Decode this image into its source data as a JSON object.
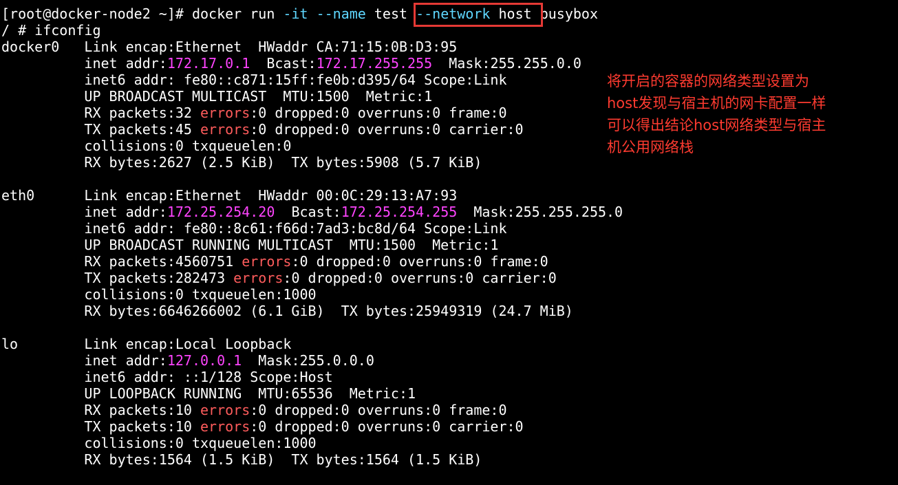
{
  "terminal": {
    "lines": [
      {
        "segments": [
          {
            "text": "[root@docker-node2 ~]# docker run ",
            "color": "default"
          },
          {
            "text": "-it",
            "color": "cyan"
          },
          {
            "text": " ",
            "color": "default"
          },
          {
            "text": "--name",
            "color": "cyan"
          },
          {
            "text": " test ",
            "color": "default"
          },
          {
            "text": "--network",
            "color": "cyan"
          },
          {
            "text": " host busybox",
            "color": "default"
          }
        ]
      },
      {
        "segments": [
          {
            "text": "/ # ifconfig",
            "color": "default"
          }
        ]
      },
      {
        "segments": [
          {
            "text": "docker0   Link encap:Ethernet  HWaddr CA:71:15:0B:D3:95",
            "color": "default"
          }
        ]
      },
      {
        "segments": [
          {
            "text": "          inet addr:",
            "color": "default"
          },
          {
            "text": "172.17.0.1",
            "color": "magenta"
          },
          {
            "text": "  Bcast:",
            "color": "default"
          },
          {
            "text": "172.17.255.255",
            "color": "magenta"
          },
          {
            "text": "  Mask:255.255.0.0",
            "color": "default"
          }
        ]
      },
      {
        "segments": [
          {
            "text": "          inet6 addr: fe80::c871:15ff:fe0b:d395/64 Scope:Link",
            "color": "default"
          }
        ]
      },
      {
        "segments": [
          {
            "text": "          UP BROADCAST MULTICAST  MTU:1500  Metric:1",
            "color": "default"
          }
        ]
      },
      {
        "segments": [
          {
            "text": "          RX packets:32 ",
            "color": "default"
          },
          {
            "text": "errors",
            "color": "red"
          },
          {
            "text": ":0 dropped:0 overruns:0 frame:0",
            "color": "default"
          }
        ]
      },
      {
        "segments": [
          {
            "text": "          TX packets:45 ",
            "color": "default"
          },
          {
            "text": "errors",
            "color": "red"
          },
          {
            "text": ":0 dropped:0 overruns:0 carrier:0",
            "color": "default"
          }
        ]
      },
      {
        "segments": [
          {
            "text": "          collisions:0 txqueuelen:0",
            "color": "default"
          }
        ]
      },
      {
        "segments": [
          {
            "text": "          RX bytes:2627 (2.5 KiB)  TX bytes:5908 (5.7 KiB)",
            "color": "default"
          }
        ]
      },
      {
        "segments": [
          {
            "text": "",
            "color": "default"
          }
        ]
      },
      {
        "segments": [
          {
            "text": "eth0      Link encap:Ethernet  HWaddr 00:0C:29:13:A7:93",
            "color": "default"
          }
        ]
      },
      {
        "segments": [
          {
            "text": "          inet addr:",
            "color": "default"
          },
          {
            "text": "172.25.254.20",
            "color": "magenta"
          },
          {
            "text": "  Bcast:",
            "color": "default"
          },
          {
            "text": "172.25.254.255",
            "color": "magenta"
          },
          {
            "text": "  Mask:255.255.255.0",
            "color": "default"
          }
        ]
      },
      {
        "segments": [
          {
            "text": "          inet6 addr: fe80::8c61:f66d:7ad3:bc8d/64 Scope:Link",
            "color": "default"
          }
        ]
      },
      {
        "segments": [
          {
            "text": "          UP BROADCAST RUNNING MULTICAST  MTU:1500  Metric:1",
            "color": "default"
          }
        ]
      },
      {
        "segments": [
          {
            "text": "          RX packets:4560751 ",
            "color": "default"
          },
          {
            "text": "errors",
            "color": "red"
          },
          {
            "text": ":0 dropped:0 overruns:0 frame:0",
            "color": "default"
          }
        ]
      },
      {
        "segments": [
          {
            "text": "          TX packets:282473 ",
            "color": "default"
          },
          {
            "text": "errors",
            "color": "red"
          },
          {
            "text": ":0 dropped:0 overruns:0 carrier:0",
            "color": "default"
          }
        ]
      },
      {
        "segments": [
          {
            "text": "          collisions:0 txqueuelen:1000",
            "color": "default"
          }
        ]
      },
      {
        "segments": [
          {
            "text": "          RX bytes:6646266002 (6.1 GiB)  TX bytes:25949319 (24.7 MiB)",
            "color": "default"
          }
        ]
      },
      {
        "segments": [
          {
            "text": "",
            "color": "default"
          }
        ]
      },
      {
        "segments": [
          {
            "text": "lo        Link encap:Local Loopback",
            "color": "default"
          }
        ]
      },
      {
        "segments": [
          {
            "text": "          inet addr:",
            "color": "default"
          },
          {
            "text": "127.0.0.1",
            "color": "magenta"
          },
          {
            "text": "  Mask:255.0.0.0",
            "color": "default"
          }
        ]
      },
      {
        "segments": [
          {
            "text": "          inet6 addr: ::1/128 Scope:Host",
            "color": "default"
          }
        ]
      },
      {
        "segments": [
          {
            "text": "          UP LOOPBACK RUNNING  MTU:65536  Metric:1",
            "color": "default"
          }
        ]
      },
      {
        "segments": [
          {
            "text": "          RX packets:10 ",
            "color": "default"
          },
          {
            "text": "errors",
            "color": "red"
          },
          {
            "text": ":0 dropped:0 overruns:0 frame:0",
            "color": "default"
          }
        ]
      },
      {
        "segments": [
          {
            "text": "          TX packets:10 ",
            "color": "default"
          },
          {
            "text": "errors",
            "color": "red"
          },
          {
            "text": ":0 dropped:0 overruns:0 carrier:0",
            "color": "default"
          }
        ]
      },
      {
        "segments": [
          {
            "text": "          collisions:0 txqueuelen:1000",
            "color": "default"
          }
        ]
      },
      {
        "segments": [
          {
            "text": "          RX bytes:1564 (1.5 KiB)  TX bytes:1564 (1.5 KiB)",
            "color": "default"
          }
        ]
      }
    ]
  },
  "annotation": {
    "lines": [
      "将开启的容器的网络类型设置为",
      "host发现与宿主机的网卡配置一样",
      "可以得出结论host网络类型与宿主",
      "机公用网络栈"
    ]
  },
  "colors": {
    "background": "#000000",
    "text": "#ffffff",
    "ip_address": "#ff44ff",
    "errors_label": "#ff5c5c",
    "flag": "#5fd7ff",
    "annotation": "#ff3b30",
    "highlight_box": "#e53935"
  }
}
